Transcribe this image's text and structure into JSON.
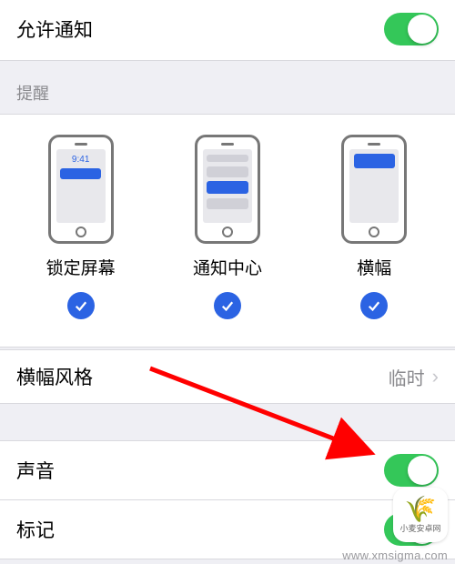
{
  "allow": {
    "label": "允许通知",
    "on": true
  },
  "alerts": {
    "header": "提醒",
    "lockTime": "9:41",
    "options": [
      {
        "label": "锁定屏幕",
        "checked": true
      },
      {
        "label": "通知中心",
        "checked": true
      },
      {
        "label": "横幅",
        "checked": true
      }
    ]
  },
  "bannerStyle": {
    "label": "横幅风格",
    "value": "临时"
  },
  "sounds": {
    "label": "声音",
    "on": true
  },
  "badges": {
    "label": "标记",
    "on": true
  },
  "watermark": {
    "text": "www.xmsigma.com",
    "logoCaption": "小麦安卓网"
  }
}
